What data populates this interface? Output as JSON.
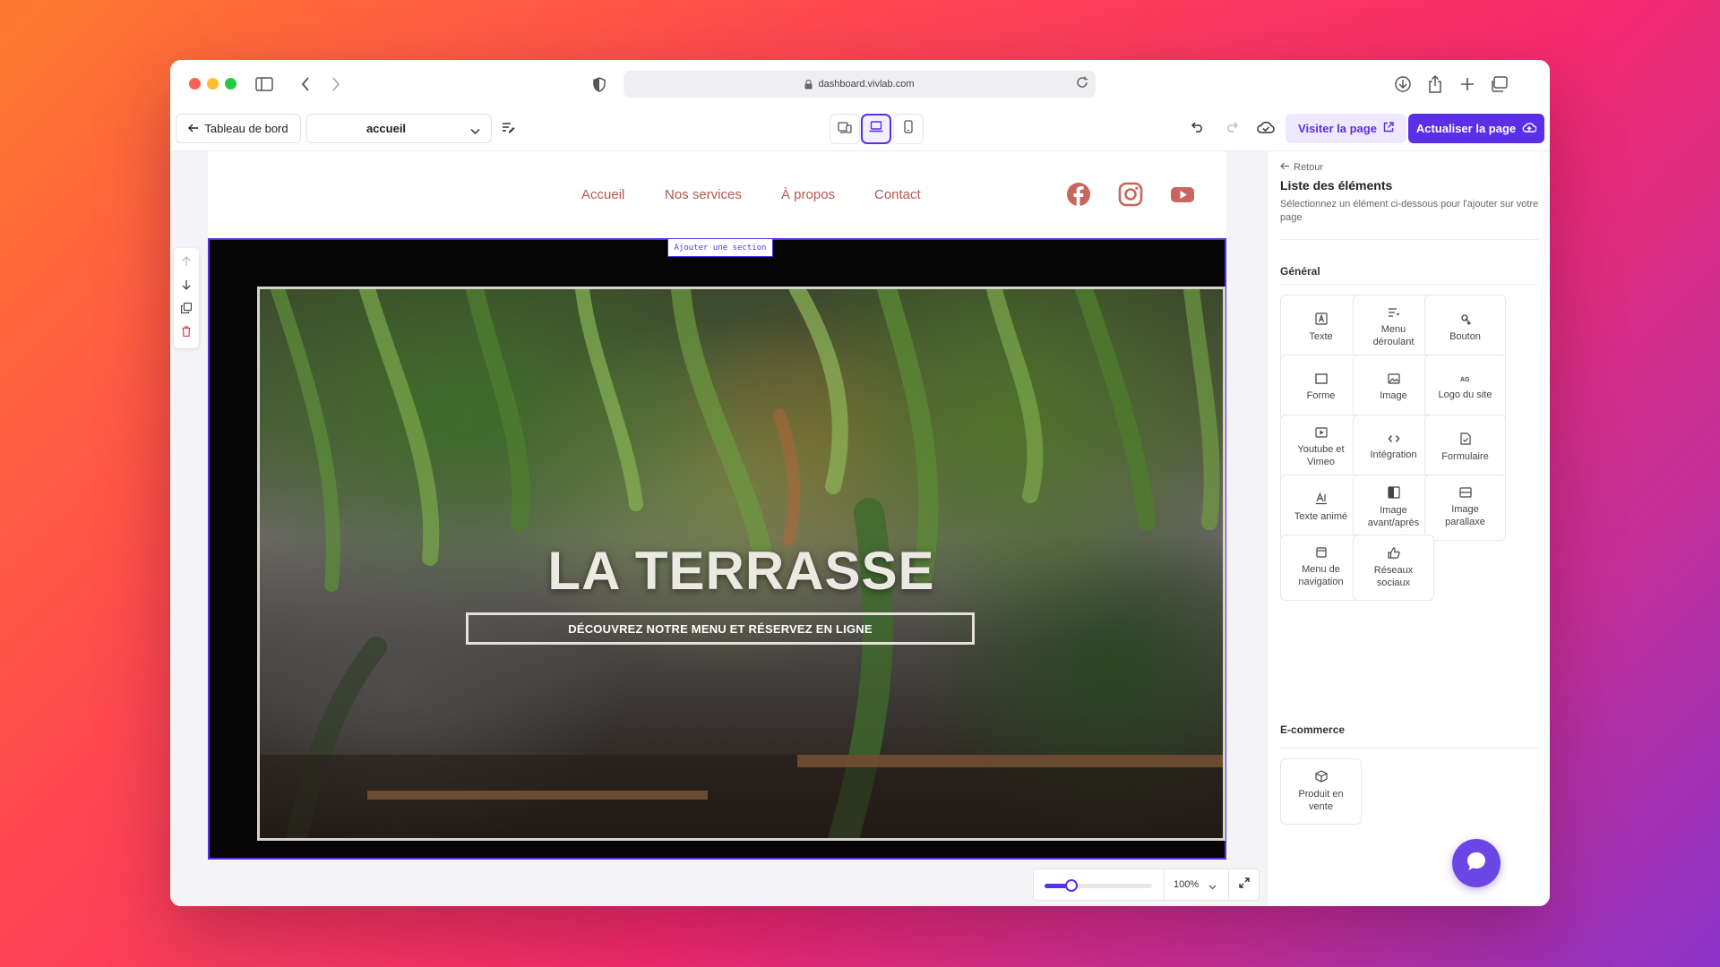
{
  "browser": {
    "url": "dashboard.vivlab.com",
    "traffic_colors": [
      "#ff5f57",
      "#febc2e",
      "#28c840"
    ]
  },
  "toolbar": {
    "back_label": "Tableau de bord",
    "page_select": "accueil",
    "visit_label": "Visiter la page",
    "update_label": "Actualiser la page",
    "accent": "#5b2ee8"
  },
  "site": {
    "nav": [
      "Accueil",
      "Nos services",
      "À propos",
      "Contact"
    ],
    "nav_color": "#b8564e",
    "social_icons": [
      "facebook-icon",
      "instagram-icon",
      "youtube-icon"
    ],
    "add_section_label": "Ajouter une section",
    "hero_title": "LA TERRASSE",
    "hero_button": "DÉCOUVREZ NOTRE MENU ET RÉSERVEZ EN LIGNE"
  },
  "zoom": {
    "value_label": "100%",
    "slider_fraction": 0.25
  },
  "panel": {
    "back_label": "Retour",
    "title": "Liste des éléments",
    "subtitle": "Sélectionnez un élément ci-dessous pour l'ajouter sur votre page",
    "general_title": "Général",
    "general_items": [
      {
        "label": "Texte",
        "icon": "text-icon"
      },
      {
        "label": "Menu déroulant",
        "icon": "dropdown-menu-icon"
      },
      {
        "label": "Bouton",
        "icon": "button-icon"
      },
      {
        "label": "Forme",
        "icon": "shape-icon"
      },
      {
        "label": "Image",
        "icon": "image-icon"
      },
      {
        "label": "Logo du site",
        "icon": "logo-icon"
      },
      {
        "label": "Youtube et Vimeo",
        "icon": "video-icon"
      },
      {
        "label": "Intégration",
        "icon": "code-icon"
      },
      {
        "label": "Formulaire",
        "icon": "form-icon"
      },
      {
        "label": "Texte animé",
        "icon": "animated-text-icon"
      },
      {
        "label": "Image avant/après",
        "icon": "before-after-icon"
      },
      {
        "label": "Image parallaxe",
        "icon": "parallax-icon"
      },
      {
        "label": "Menu de navigation",
        "icon": "navigation-menu-icon"
      },
      {
        "label": "Réseaux sociaux",
        "icon": "social-networks-icon"
      }
    ],
    "ecommerce_title": "E-commerce",
    "ecommerce_items": [
      {
        "label": "Produit en vente",
        "icon": "product-icon"
      }
    ]
  }
}
